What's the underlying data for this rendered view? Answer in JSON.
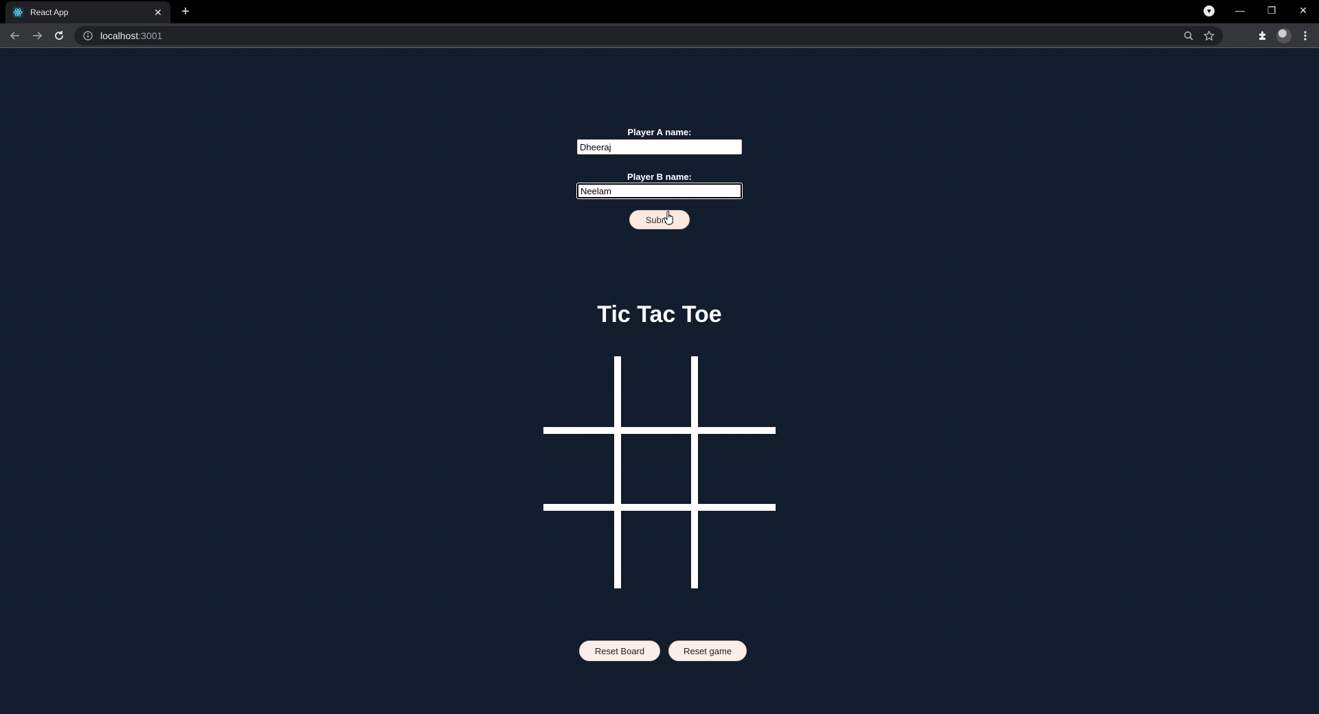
{
  "browser": {
    "tab_title": "React App",
    "url_host": "localhost",
    "url_port": ":3001",
    "icons": [
      "react-icon",
      "close-icon",
      "plus-icon",
      "back-arrow-icon",
      "forward-arrow-icon",
      "reload-icon",
      "info-icon",
      "zoom-icon",
      "star-icon",
      "extensions-icon",
      "menu-icon"
    ]
  },
  "form": {
    "player_a_label": "Player A name:",
    "player_a_value": "Dheeraj",
    "player_b_label": "Player B name:",
    "player_b_value": "Neelam",
    "submit_label": "Submit"
  },
  "game": {
    "title": "Tic Tac Toe",
    "cells": [
      "",
      "",
      "",
      "",
      "",
      "",
      "",
      "",
      ""
    ]
  },
  "actions": {
    "reset_board_label": "Reset Board",
    "reset_game_label": "Reset game"
  },
  "colors": {
    "page_background": "#0f1a2b",
    "button_background": "#fbe8e0",
    "grid_lines": "#ffffff"
  }
}
